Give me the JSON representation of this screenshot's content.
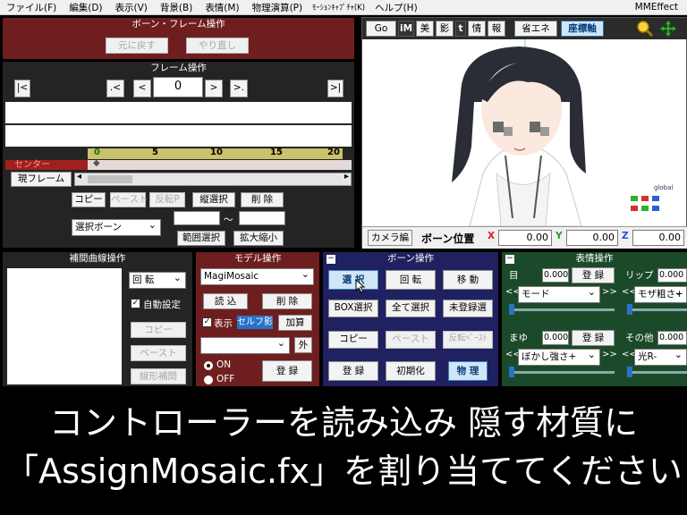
{
  "menu": {
    "items": [
      "ファイル(F)",
      "編集(D)",
      "表示(V)",
      "背景(B)",
      "表情(M)",
      "物理演算(P)",
      "ﾓｰｼｮﾝｷｬﾌﾟﾁｬ(K)",
      "ヘルプ(H)"
    ],
    "app_name": "MMEffect"
  },
  "bone_frame": {
    "title": "ボーン・フレーム操作",
    "undo": "元に戻す",
    "redo": "やり直し"
  },
  "frame": {
    "title": "フレーム操作",
    "first": "|<",
    "prev_key": ".<",
    "prev": "<",
    "current": "0",
    "next": ">",
    "next_key": ">.",
    "last": ">|",
    "ticks": [
      "0",
      "5",
      "10",
      "15",
      "20"
    ],
    "track_label": "センター",
    "current_frame_btn": "現フレーム",
    "copy": "コピー",
    "paste": "ペースト",
    "reverse_paste": "反転P",
    "vertical_select": "縦選択",
    "delete": "削 除",
    "select_bone": "選択ボーン",
    "tilde": "～",
    "range_select": "範囲選択",
    "scale": "拡大縮小"
  },
  "view": {
    "go": "Go",
    "im": "iM",
    "tabs": [
      "美",
      "影",
      "t",
      "情",
      "報"
    ],
    "eco": "省エネ",
    "coord": "座標軸",
    "global": "global",
    "camera_tab": "カメラ編",
    "bone_pos_label": "ボーン位置",
    "x_label": "X",
    "x": "0.00",
    "y_label": "Y",
    "y": "0.00",
    "z_label": "Z",
    "z": "0.00"
  },
  "curve": {
    "title": "補間曲線操作",
    "select": "回 転",
    "auto_label": "自動設定",
    "copy": "コピー",
    "paste": "ペースト",
    "linear": "線形補間"
  },
  "model": {
    "title": "モデル操作",
    "model_select": "MagiMosaic",
    "load": "読 込",
    "delete": "削 除",
    "display": "表示",
    "self_shadow": "セルフ影",
    "add": "加算",
    "outer": "外",
    "on": "ON",
    "off": "OFF",
    "register": "登 録"
  },
  "bone": {
    "title": "ボーン操作",
    "select": "選 択",
    "rotate": "回 転",
    "move": "移 動",
    "box_select": "BOX選択",
    "select_all": "全て選択",
    "unregistered": "未登録選",
    "copy": "コピー",
    "paste": "ペースト",
    "reverse_paste": "反転ﾍﾟｰｽﾄ",
    "register": "登 録",
    "init": "初期化",
    "physics": "物 理"
  },
  "morph": {
    "title": "表情操作",
    "eye_label": "目",
    "eye_value": "0.000",
    "eye_register": "登 録",
    "eye_select": "モード",
    "lip_label": "リップ",
    "lip_value": "0.000",
    "lip_select": "モザ粗さ+",
    "brow_label": "まゆ",
    "brow_value": "0.000",
    "brow_register": "登 録",
    "brow_select": "ぼかし強さ+",
    "other_label": "その他",
    "other_value": "0.000",
    "other_select": "光R-"
  },
  "caption": {
    "line1": "コントローラーを読み込み 隠す材質に",
    "line2": "「AssignMosaic.fx」を割り当ててください"
  }
}
